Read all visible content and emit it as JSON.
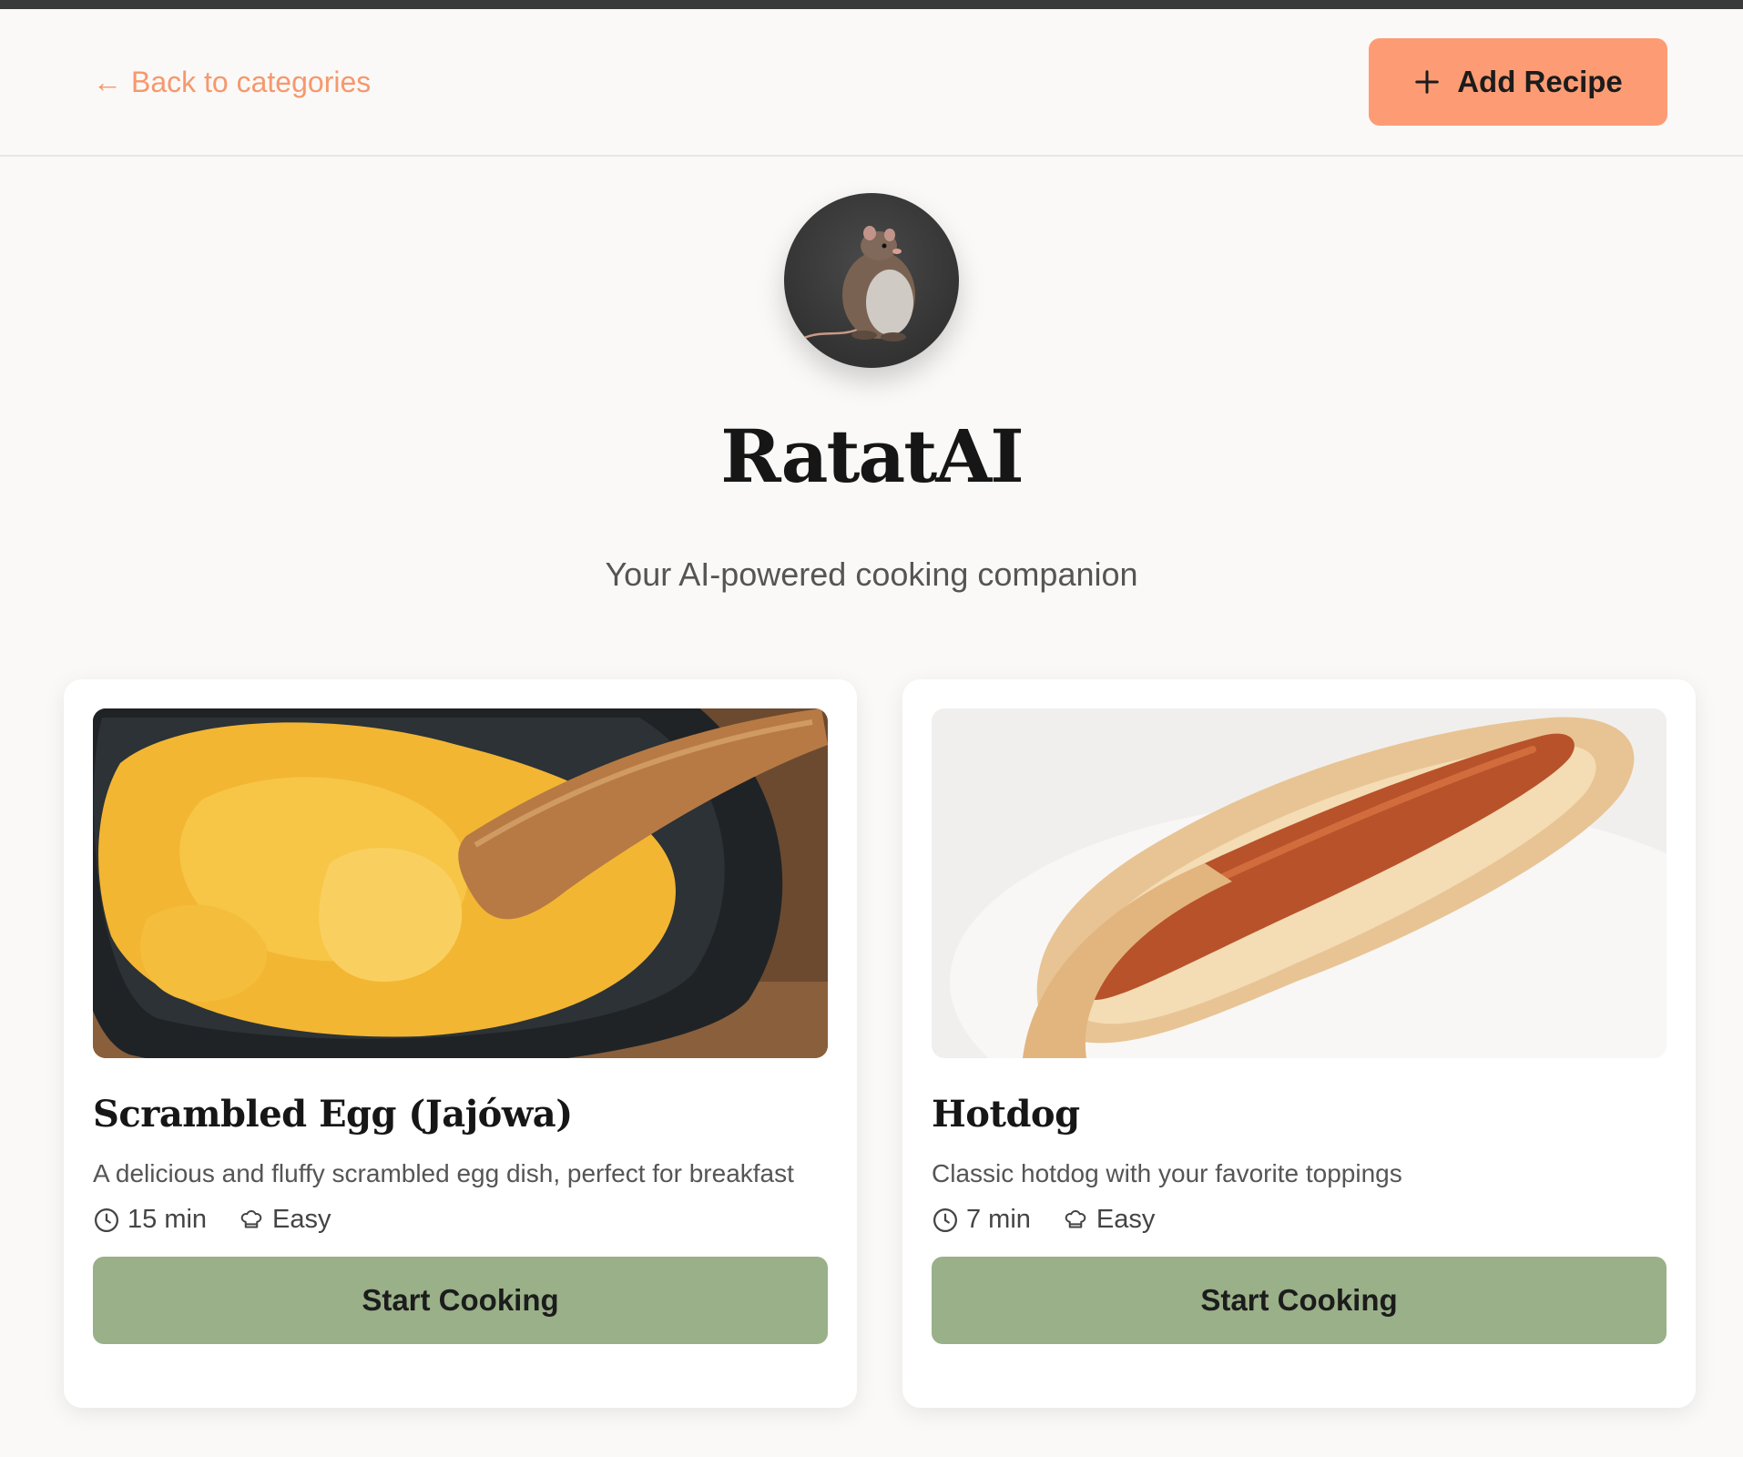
{
  "header": {
    "back_label": "Back to categories",
    "add_recipe_label": "Add Recipe"
  },
  "hero": {
    "title": "RatatAI",
    "tagline": "Your AI-powered cooking companion"
  },
  "recipes": [
    {
      "title": "Scrambled Egg (Jajówa)",
      "description": "A delicious and fluffy scrambled egg dish, perfect for breakfast",
      "time": "15 min",
      "difficulty": "Easy",
      "cta": "Start Cooking"
    },
    {
      "title": "Hotdog",
      "description": "Classic hotdog with your favorite toppings",
      "time": "7 min",
      "difficulty": "Easy",
      "cta": "Start Cooking"
    }
  ],
  "colors": {
    "accent_orange": "#fd9c74",
    "link_orange": "#f6986d",
    "button_green": "#9ab088",
    "background": "#faf9f7"
  },
  "icons": [
    "arrow-left-icon",
    "plus-icon",
    "clock-icon",
    "chef-hat-icon"
  ]
}
